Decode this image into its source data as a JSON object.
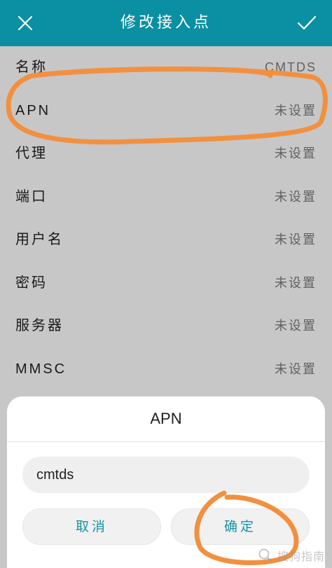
{
  "header": {
    "title": "修改接入点",
    "close_icon": "close-icon",
    "confirm_icon": "check-icon",
    "background_color": "#0b8fa3"
  },
  "settings": [
    {
      "label": "名称",
      "value": "CMTDS"
    },
    {
      "label": "APN",
      "value": "未设置"
    },
    {
      "label": "代理",
      "value": "未设置"
    },
    {
      "label": "端口",
      "value": "未设置"
    },
    {
      "label": "用户名",
      "value": "未设置"
    },
    {
      "label": "密码",
      "value": "未设置"
    },
    {
      "label": "服务器",
      "value": "未设置"
    },
    {
      "label": "MMSC",
      "value": "未设置"
    }
  ],
  "dialog": {
    "title": "APN",
    "input_value": "cmtds",
    "cancel_label": "取消",
    "ok_label": "确定",
    "accent_color": "#1592a8"
  },
  "annotations": {
    "ring_color": "#f2903f"
  },
  "watermark": {
    "text": "搜狗指南"
  }
}
